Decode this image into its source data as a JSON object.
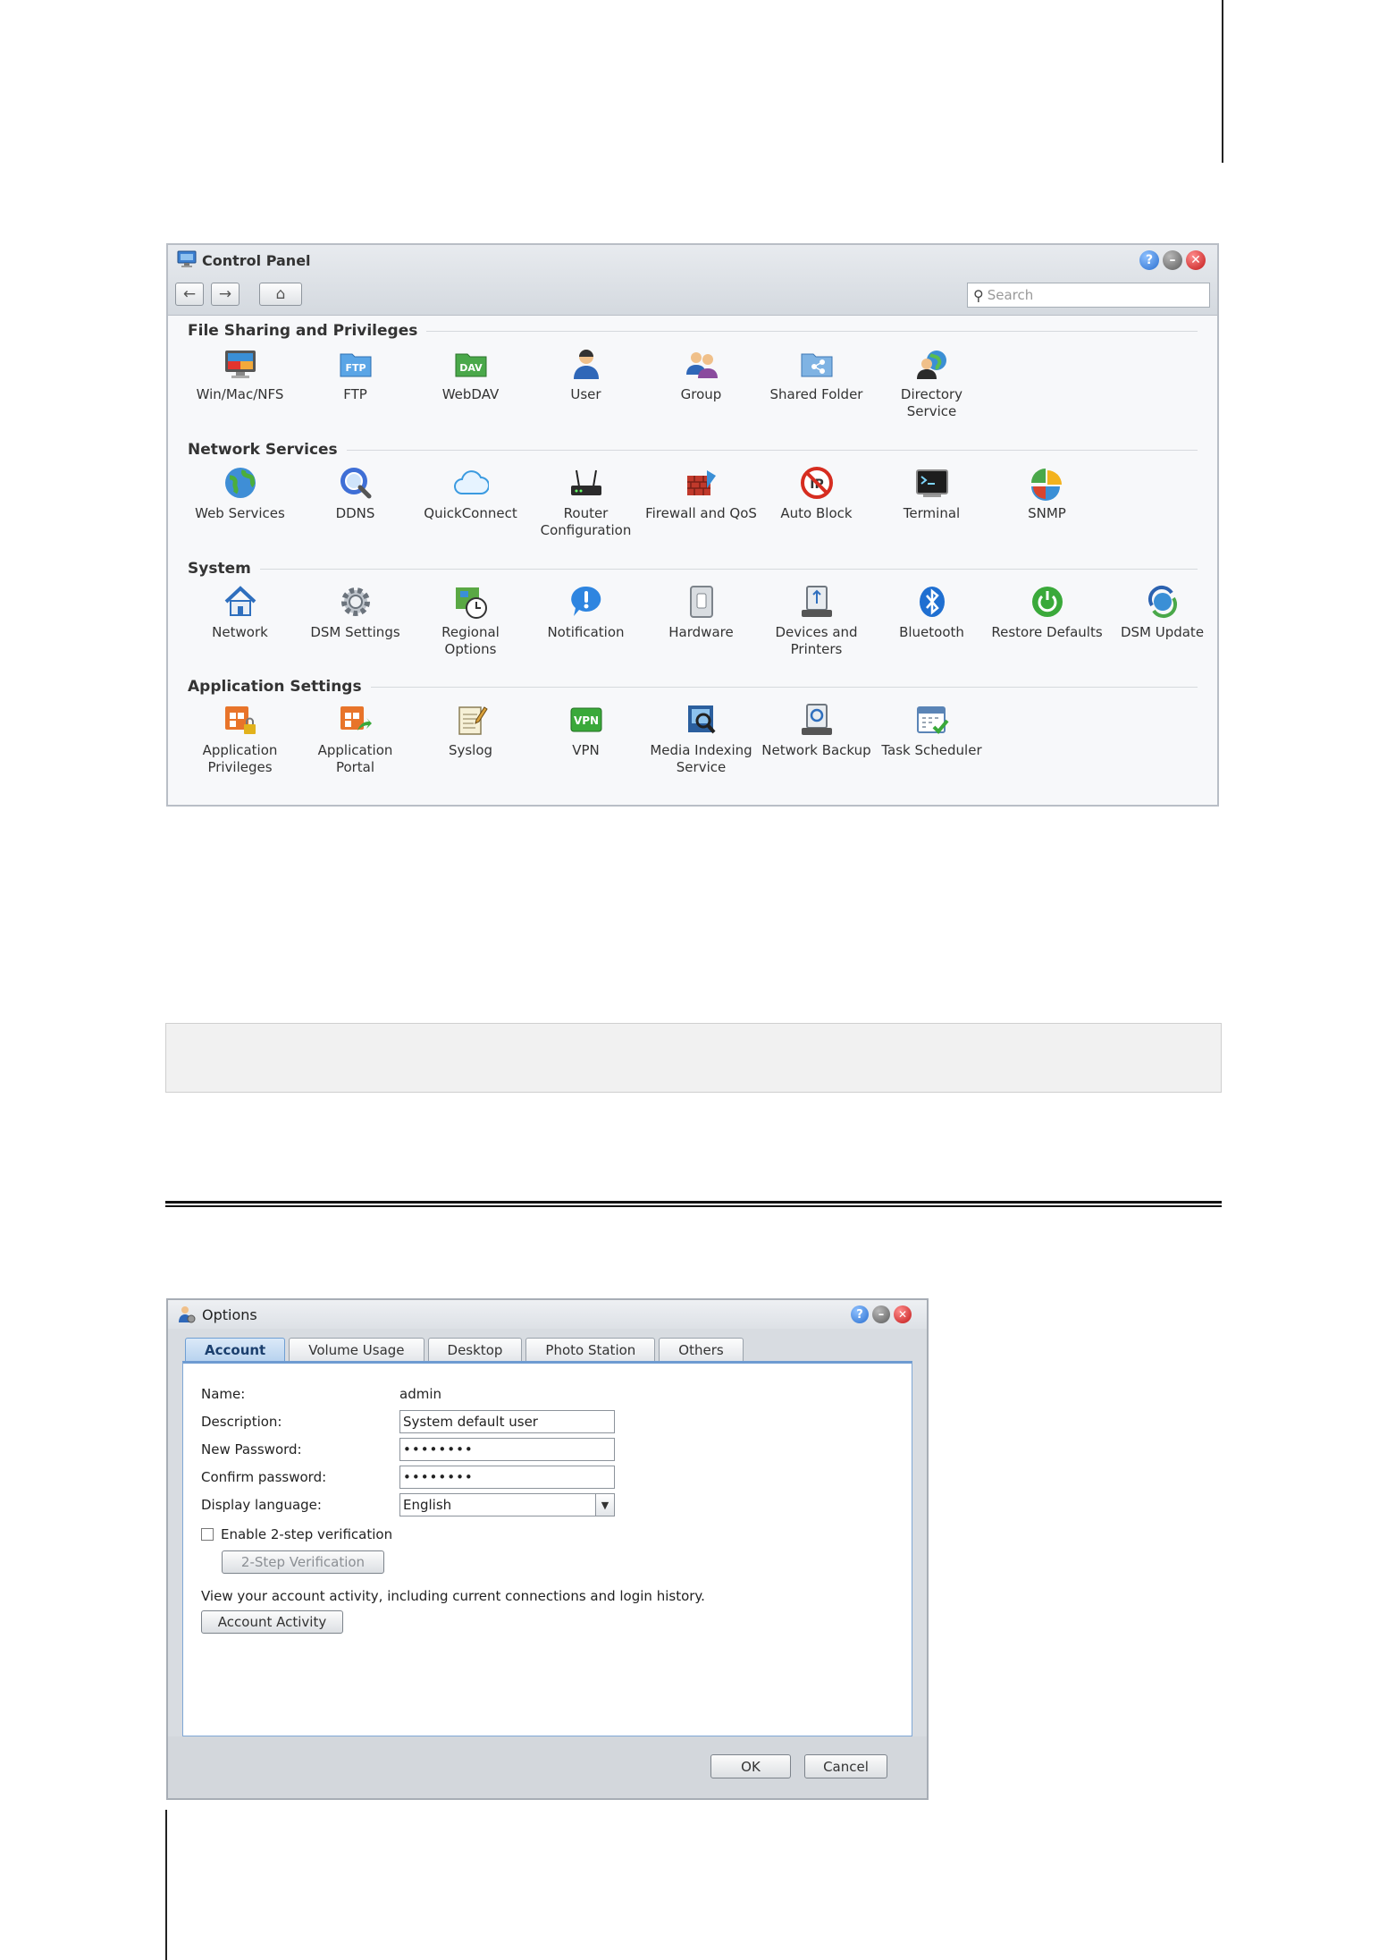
{
  "control_panel": {
    "title": "Control Panel",
    "search_placeholder": "Search",
    "sections": [
      {
        "title": "File Sharing and Privileges",
        "items": [
          {
            "name": "Win/Mac/NFS"
          },
          {
            "name": "FTP"
          },
          {
            "name": "WebDAV"
          },
          {
            "name": "User"
          },
          {
            "name": "Group"
          },
          {
            "name": "Shared Folder"
          },
          {
            "name": "Directory Service"
          }
        ]
      },
      {
        "title": "Network Services",
        "items": [
          {
            "name": "Web Services"
          },
          {
            "name": "DDNS"
          },
          {
            "name": "QuickConnect"
          },
          {
            "name": "Router Configuration"
          },
          {
            "name": "Firewall and QoS"
          },
          {
            "name": "Auto Block"
          },
          {
            "name": "Terminal"
          },
          {
            "name": "SNMP"
          }
        ]
      },
      {
        "title": "System",
        "items": [
          {
            "name": "Network"
          },
          {
            "name": "DSM Settings"
          },
          {
            "name": "Regional Options"
          },
          {
            "name": "Notification"
          },
          {
            "name": "Hardware"
          },
          {
            "name": "Devices and Printers"
          },
          {
            "name": "Bluetooth"
          },
          {
            "name": "Restore Defaults"
          },
          {
            "name": "DSM Update"
          }
        ]
      },
      {
        "title": "Application Settings",
        "items": [
          {
            "name": "Application Privileges"
          },
          {
            "name": "Application Portal"
          },
          {
            "name": "Syslog"
          },
          {
            "name": "VPN"
          },
          {
            "name": "Media Indexing Service"
          },
          {
            "name": "Network Backup"
          },
          {
            "name": "Task Scheduler"
          }
        ]
      }
    ],
    "icon_texts": {
      "ftp": "FTP",
      "dav": "DAV",
      "vpn": "VPN"
    }
  },
  "options": {
    "title": "Options",
    "tabs": [
      "Account",
      "Volume Usage",
      "Desktop",
      "Photo Station",
      "Others"
    ],
    "active_tab": "Account",
    "fields": {
      "name_label": "Name:",
      "name_value": "admin",
      "description_label": "Description:",
      "description_value": "System default user",
      "new_password_label": "New Password:",
      "new_password_value": "••••••••",
      "confirm_password_label": "Confirm password:",
      "confirm_password_value": "••••••••",
      "display_language_label": "Display language:",
      "display_language_value": "English"
    },
    "two_step_checkbox_label": "Enable 2-step verification",
    "two_step_checked": false,
    "two_step_button": "2-Step Verification",
    "activity_text": "View your account activity, including current connections and login history.",
    "activity_button": "Account Activity",
    "ok_button": "OK",
    "cancel_button": "Cancel"
  },
  "colors": {
    "accent": "#6e9bd1",
    "help": "#2a6fcf",
    "close": "#c21818"
  }
}
